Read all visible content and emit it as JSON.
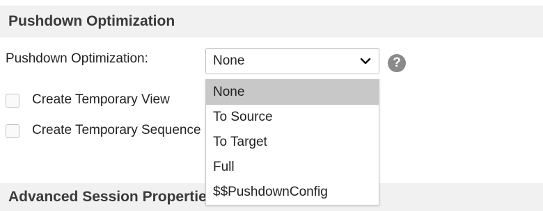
{
  "section1": {
    "title": "Pushdown Optimization"
  },
  "pushdown": {
    "label": "Pushdown Optimization:",
    "selected": "None",
    "options": [
      "None",
      "To Source",
      "To Target",
      "Full",
      "$$PushdownConfig"
    ]
  },
  "help": {
    "glyph": "?"
  },
  "checkboxes": [
    {
      "label": "Create Temporary View",
      "checked": false
    },
    {
      "label": "Create Temporary Sequence",
      "checked": false
    }
  ],
  "section2": {
    "title": "Advanced Session Properties"
  },
  "icons": {
    "dropdown": "chevron-down-icon",
    "help": "help-icon"
  }
}
